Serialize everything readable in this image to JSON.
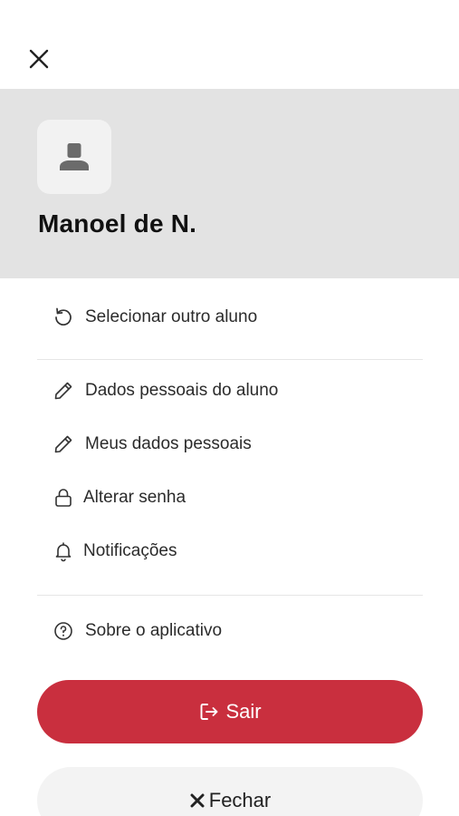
{
  "profile": {
    "name": "Manoel de N."
  },
  "menu": {
    "select_student": "Selecionar outro aluno",
    "student_personal_data": "Dados pessoais do aluno",
    "my_personal_data": "Meus dados pessoais",
    "change_password": "Alterar senha",
    "notifications": "Notificações",
    "about_app": "Sobre o aplicativo"
  },
  "buttons": {
    "logout": "Sair",
    "close": "Fechar"
  },
  "colors": {
    "accent": "#c92f3e",
    "profile_bg": "#e3e3e3"
  }
}
